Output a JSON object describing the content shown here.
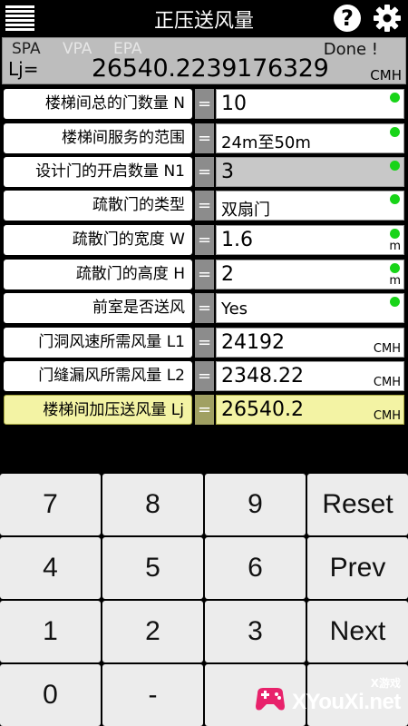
{
  "app": {
    "title": "正压送风量"
  },
  "result": {
    "modes": [
      "SPA",
      "VPA",
      "EPA"
    ],
    "status": "Done !",
    "label": "Lj=",
    "value": "26540.2239176329",
    "unit": "CMH"
  },
  "rows": [
    {
      "label": "楼梯间总的门数量  N",
      "eq": "=",
      "value": "10",
      "unit": "",
      "indicator": true
    },
    {
      "label": "楼梯间服务的范围",
      "eq": "=",
      "value": "24m至50m",
      "unit": "",
      "indicator": true
    },
    {
      "label": "设计门的开启数量 N1",
      "eq": "=",
      "value": "3",
      "unit": "",
      "indicator": true
    },
    {
      "label": "疏散门的类型",
      "eq": "=",
      "value": "双扇门",
      "unit": "",
      "indicator": true
    },
    {
      "label": "疏散门的宽度  W",
      "eq": "=",
      "value": "1.6",
      "unit": "m",
      "indicator": true
    },
    {
      "label": "疏散门的高度  H",
      "eq": "=",
      "value": "2",
      "unit": "m",
      "indicator": true
    },
    {
      "label": "前室是否送风",
      "eq": "=",
      "value": "Yes",
      "unit": "",
      "indicator": true
    },
    {
      "label": "门洞风速所需风量 L1",
      "eq": "=",
      "value": "24192",
      "unit": "CMH",
      "indicator": false
    },
    {
      "label": "门缝漏风所需风量 L2",
      "eq": "=",
      "value": "2348.22",
      "unit": "CMH",
      "indicator": false
    },
    {
      "label": "楼梯间加压送风量  Lj",
      "eq": "=",
      "value": "26540.2",
      "unit": "CMH",
      "indicator": false
    }
  ],
  "keypad": [
    "7",
    "8",
    "9",
    "Reset",
    "4",
    "5",
    "6",
    "Prev",
    "1",
    "2",
    "3",
    "Next",
    "0",
    "-",
    "",
    ""
  ],
  "watermark": {
    "small": "X游戏",
    "text": "XYouXi.net"
  },
  "colors": {
    "indicator": "#18d418",
    "highlight": "#f3f3a4",
    "result_bg": "#bdbdbd"
  }
}
